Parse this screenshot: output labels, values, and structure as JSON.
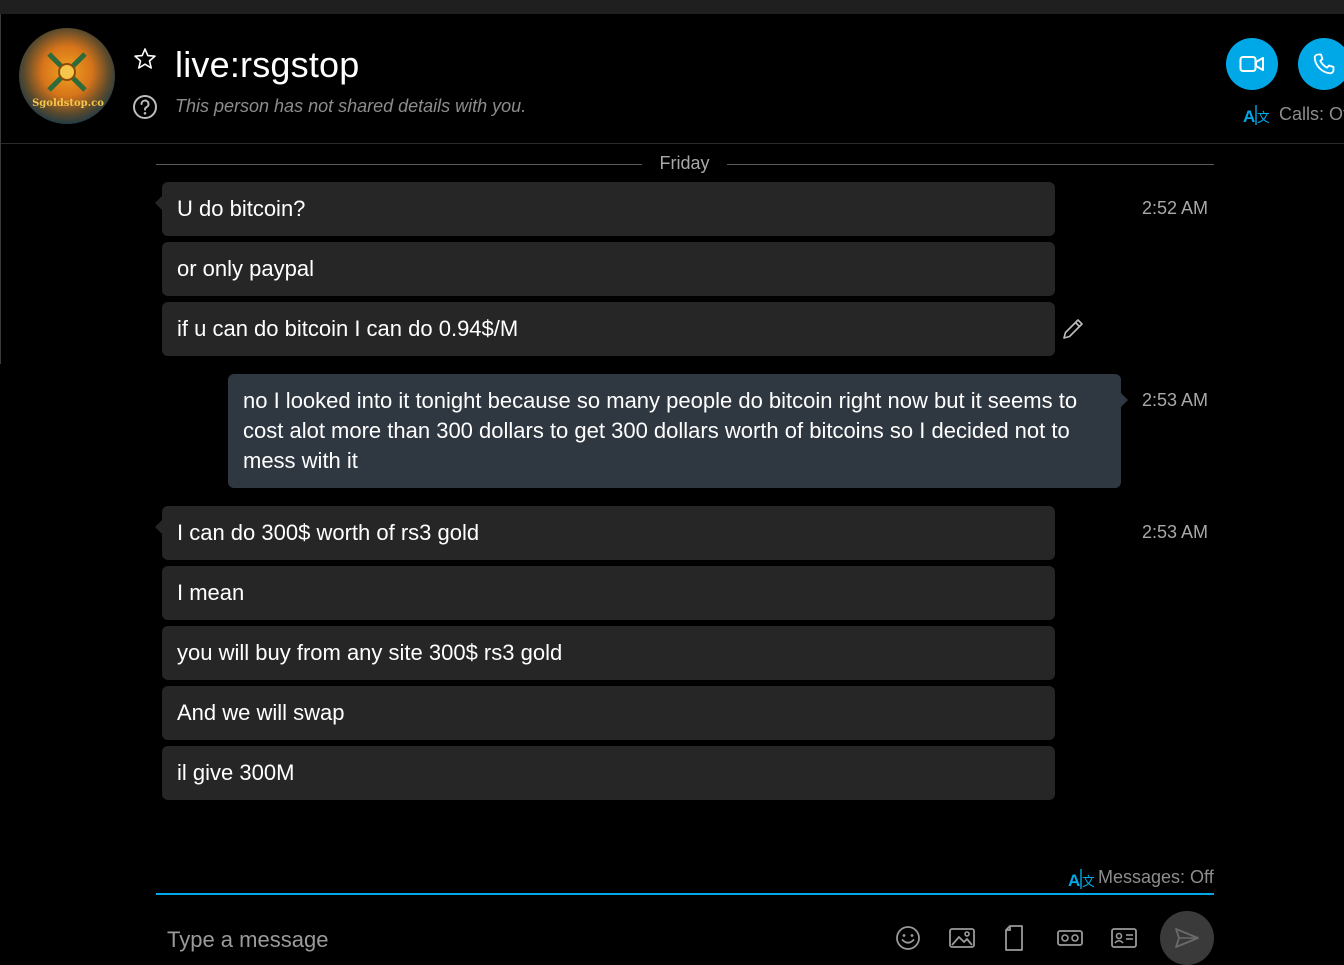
{
  "header": {
    "contact_name": "live:rsgstop",
    "subtitle": "This person has not shared details with you.",
    "avatar_text": "Sgoldstop.co",
    "calls_status": "Calls: Of"
  },
  "conversation": {
    "day_separator": "Friday",
    "incoming_group_1": {
      "timestamp": "2:52 AM",
      "messages": [
        "U do bitcoin?",
        "or only paypal",
        "if u can do bitcoin I can do 0.94$/M"
      ]
    },
    "outgoing": {
      "timestamp": "2:53 AM",
      "text": "no I looked into it tonight because so many people do bitcoin right now but it seems to cost alot more than 300 dollars to get 300 dollars worth of bitcoins so I decided not to mess with it"
    },
    "incoming_group_2": {
      "timestamp": "2:53 AM",
      "messages": [
        "I can do 300$ worth of rs3 gold",
        "I mean",
        "you will buy from any site 300$ rs3 gold",
        "And we will swap",
        "il give 300M"
      ]
    }
  },
  "composer": {
    "messages_status": "Messages: Off",
    "placeholder": "Type a message"
  },
  "colors": {
    "accent": "#00a8e8",
    "incoming_bubble": "#262626",
    "outgoing_bubble": "#2f3741",
    "background": "#000000"
  }
}
